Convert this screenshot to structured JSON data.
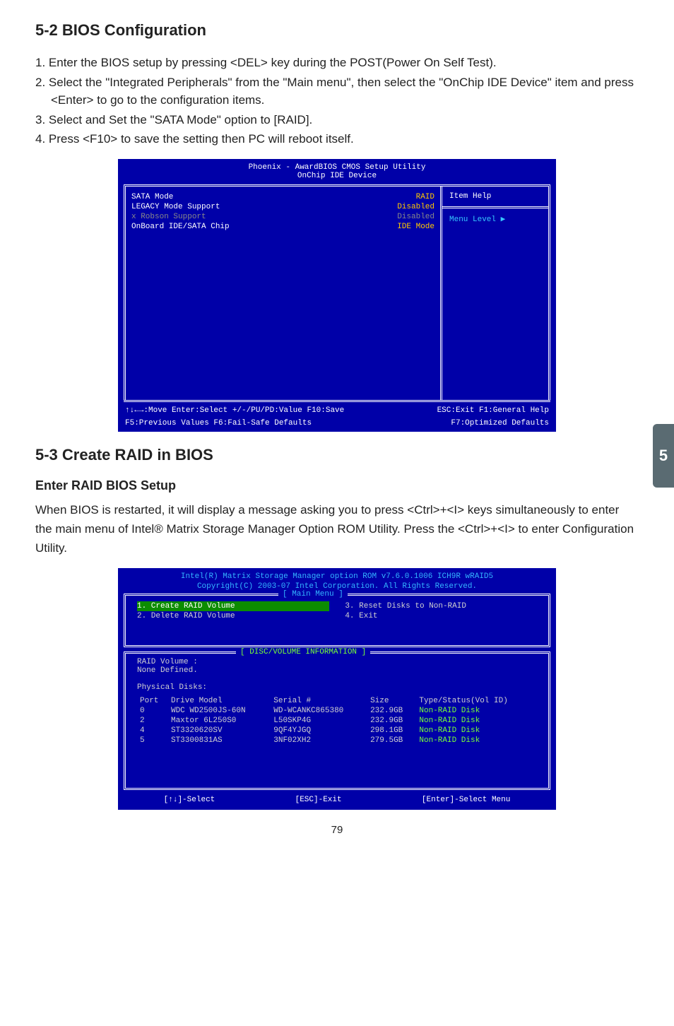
{
  "doc": {
    "h_5_2": "5-2 BIOS Configuration",
    "h_5_3": "5-3 Create RAID in BIOS",
    "sub_enter": "Enter  RAID BIOS Setup",
    "steps": [
      "1. Enter the BIOS setup by pressing <DEL> key during the POST(Power On Self Test).",
      "2. Select the \"Integrated Peripherals\" from the \"Main menu\", then select the \"OnChip IDE Device\" item and press <Enter> to go to the configuration items.",
      "3. Select and Set the \"SATA Mode\" option to [RAID].",
      "4. Press <F10> to save the setting then PC will reboot itself."
    ],
    "para2": "When BIOS is restarted, it will display a message asking you to press <Ctrl>+<I> keys simultaneously to enter the main menu of Intel® Matrix Storage Manager Option ROM Utility. Press the <Ctrl>+<I> to enter Configuration Utility.",
    "pgnum": "79",
    "side_tab": "5"
  },
  "bios": {
    "title1": "Phoenix - AwardBIOS CMOS Setup Utility",
    "title2": "OnChip IDE Device",
    "rows": [
      {
        "lbl": "  SATA Mode",
        "val": "RAID",
        "lcls": "lbl-w",
        "vcls": "val-y"
      },
      {
        "lbl": "  LEGACY Mode Support",
        "val": "Disabled",
        "lcls": "lbl-w",
        "vcls": "val-y"
      },
      {
        "lbl": "x Robson Support",
        "val": "Disabled",
        "lcls": "dis",
        "vcls": "dis"
      },
      {
        "lbl": "  OnBoard IDE/SATA Chip",
        "val": "IDE Mode",
        "lcls": "lbl-w",
        "vcls": "val-y"
      }
    ],
    "help_title": "Item Help",
    "help_body": "Menu Level  ▶",
    "footer_l": "↑↓←→:Move  Enter:Select   +/-/PU/PD:Value  F10:Save",
    "footer_r": "ESC:Exit  F1:General Help",
    "footer_l2": "F5:Previous Values       F6:Fail-Safe Defaults",
    "footer_r2": "F7:Optimized Defaults"
  },
  "raid": {
    "title": "Intel(R) Matrix Storage Manager option ROM v7.6.0.1006 ICH9R wRAID5",
    "copyright": "Copyright(C) 2003-07 Intel Corporation.  All Rights Reserved.",
    "menu_label": "[ Main Menu ]",
    "menu_left": [
      {
        "t": "1. Create RAID Volume",
        "sel": true
      },
      {
        "t": "2. Delete RAID Volume",
        "sel": false
      }
    ],
    "menu_right": [
      {
        "t": "3. Reset Disks to Non-RAID",
        "sel": false
      },
      {
        "t": "4. Exit",
        "sel": false
      }
    ],
    "info_label": "[ DISC/VOLUME INFORMATION ]",
    "vol_label": "RAID Volume :",
    "vol_none": "None Defined.",
    "phys_label": "Physical Disks:",
    "cols": {
      "c1": "Port",
      "c2": "Drive Model",
      "c3": "Serial #",
      "c4": "Size",
      "c5": "Type/Status(Vol ID)"
    },
    "disks": [
      {
        "port": "0",
        "model": "WDC WD2500JS-60N",
        "serial": "WD-WCANKC865380",
        "size": "232.9GB",
        "type": "Non-RAID Disk"
      },
      {
        "port": "2",
        "model": "Maxtor 6L250S0",
        "serial": "L50SKP4G",
        "size": "232.9GB",
        "type": "Non-RAID Disk"
      },
      {
        "port": "4",
        "model": "ST3320620SV",
        "serial": "9QF4YJGQ",
        "size": "298.1GB",
        "type": "Non-RAID Disk"
      },
      {
        "port": "5",
        "model": "ST3300831AS",
        "serial": "3NF02XH2",
        "size": "279.5GB",
        "type": "Non-RAID Disk"
      }
    ],
    "footer": {
      "sel": "[↑↓]-Select",
      "exit": "[ESC]-Exit",
      "enter": "[Enter]-Select Menu"
    }
  }
}
